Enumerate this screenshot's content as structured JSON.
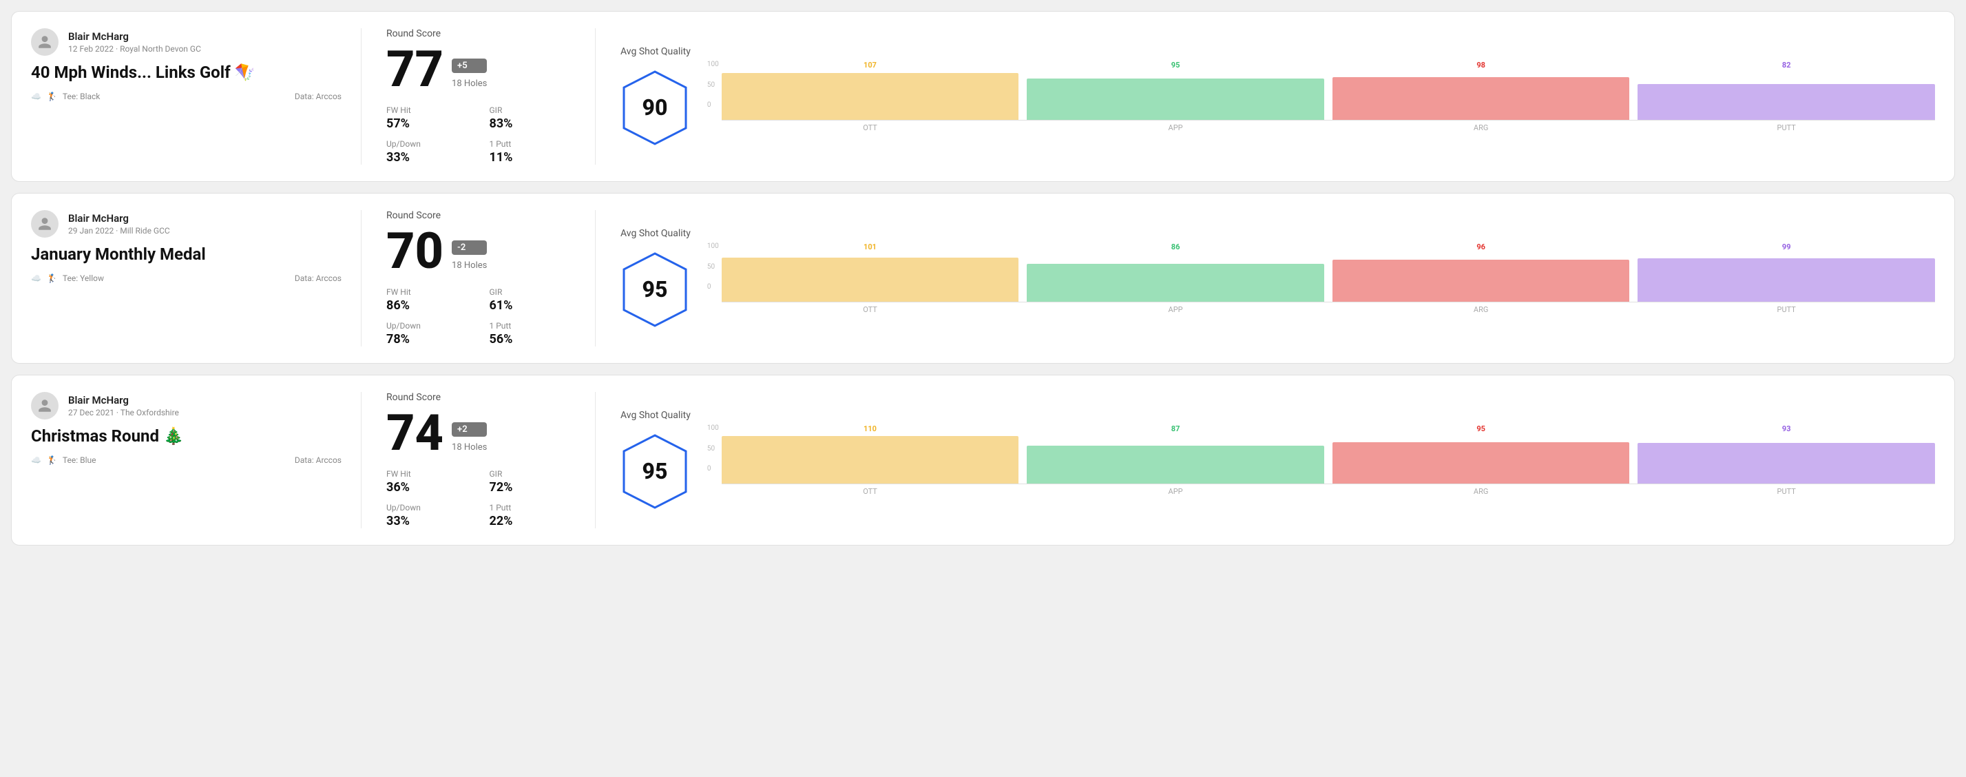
{
  "rounds": [
    {
      "user_name": "Blair McHarg",
      "user_meta": "12 Feb 2022 · Royal North Devon GC",
      "round_title": "40 Mph Winds... Links Golf 🪁",
      "tee": "Black",
      "data_source": "Data: Arccos",
      "round_score_label": "Round Score",
      "score": "77",
      "badge": "+5",
      "badge_type": "positive",
      "holes": "18 Holes",
      "fw_hit_label": "FW Hit",
      "fw_hit_value": "57%",
      "gir_label": "GIR",
      "gir_value": "83%",
      "updown_label": "Up/Down",
      "updown_value": "33%",
      "oneputt_label": "1 Putt",
      "oneputt_value": "11%",
      "avg_quality_label": "Avg Shot Quality",
      "quality_score": "90",
      "chart": {
        "bars": [
          {
            "label": "OTT",
            "value": 107,
            "color": "#f0b429"
          },
          {
            "label": "APP",
            "value": 95,
            "color": "#38c172"
          },
          {
            "label": "ARG",
            "value": 98,
            "color": "#e3342f"
          },
          {
            "label": "PUTT",
            "value": 82,
            "color": "#9561e2"
          }
        ],
        "y_max": 100,
        "y_labels": [
          "100",
          "50",
          "0"
        ]
      }
    },
    {
      "user_name": "Blair McHarg",
      "user_meta": "29 Jan 2022 · Mill Ride GCC",
      "round_title": "January Monthly Medal",
      "tee": "Yellow",
      "data_source": "Data: Arccos",
      "round_score_label": "Round Score",
      "score": "70",
      "badge": "-2",
      "badge_type": "negative",
      "holes": "18 Holes",
      "fw_hit_label": "FW Hit",
      "fw_hit_value": "86%",
      "gir_label": "GIR",
      "gir_value": "61%",
      "updown_label": "Up/Down",
      "updown_value": "78%",
      "oneputt_label": "1 Putt",
      "oneputt_value": "56%",
      "avg_quality_label": "Avg Shot Quality",
      "quality_score": "95",
      "chart": {
        "bars": [
          {
            "label": "OTT",
            "value": 101,
            "color": "#f0b429"
          },
          {
            "label": "APP",
            "value": 86,
            "color": "#38c172"
          },
          {
            "label": "ARG",
            "value": 96,
            "color": "#e3342f"
          },
          {
            "label": "PUTT",
            "value": 99,
            "color": "#9561e2"
          }
        ],
        "y_max": 100,
        "y_labels": [
          "100",
          "50",
          "0"
        ]
      }
    },
    {
      "user_name": "Blair McHarg",
      "user_meta": "27 Dec 2021 · The Oxfordshire",
      "round_title": "Christmas Round 🎄",
      "tee": "Blue",
      "data_source": "Data: Arccos",
      "round_score_label": "Round Score",
      "score": "74",
      "badge": "+2",
      "badge_type": "positive",
      "holes": "18 Holes",
      "fw_hit_label": "FW Hit",
      "fw_hit_value": "36%",
      "gir_label": "GIR",
      "gir_value": "72%",
      "updown_label": "Up/Down",
      "updown_value": "33%",
      "oneputt_label": "1 Putt",
      "oneputt_value": "22%",
      "avg_quality_label": "Avg Shot Quality",
      "quality_score": "95",
      "chart": {
        "bars": [
          {
            "label": "OTT",
            "value": 110,
            "color": "#f0b429"
          },
          {
            "label": "APP",
            "value": 87,
            "color": "#38c172"
          },
          {
            "label": "ARG",
            "value": 95,
            "color": "#e3342f"
          },
          {
            "label": "PUTT",
            "value": 93,
            "color": "#9561e2"
          }
        ],
        "y_max": 100,
        "y_labels": [
          "100",
          "50",
          "0"
        ]
      }
    }
  ]
}
